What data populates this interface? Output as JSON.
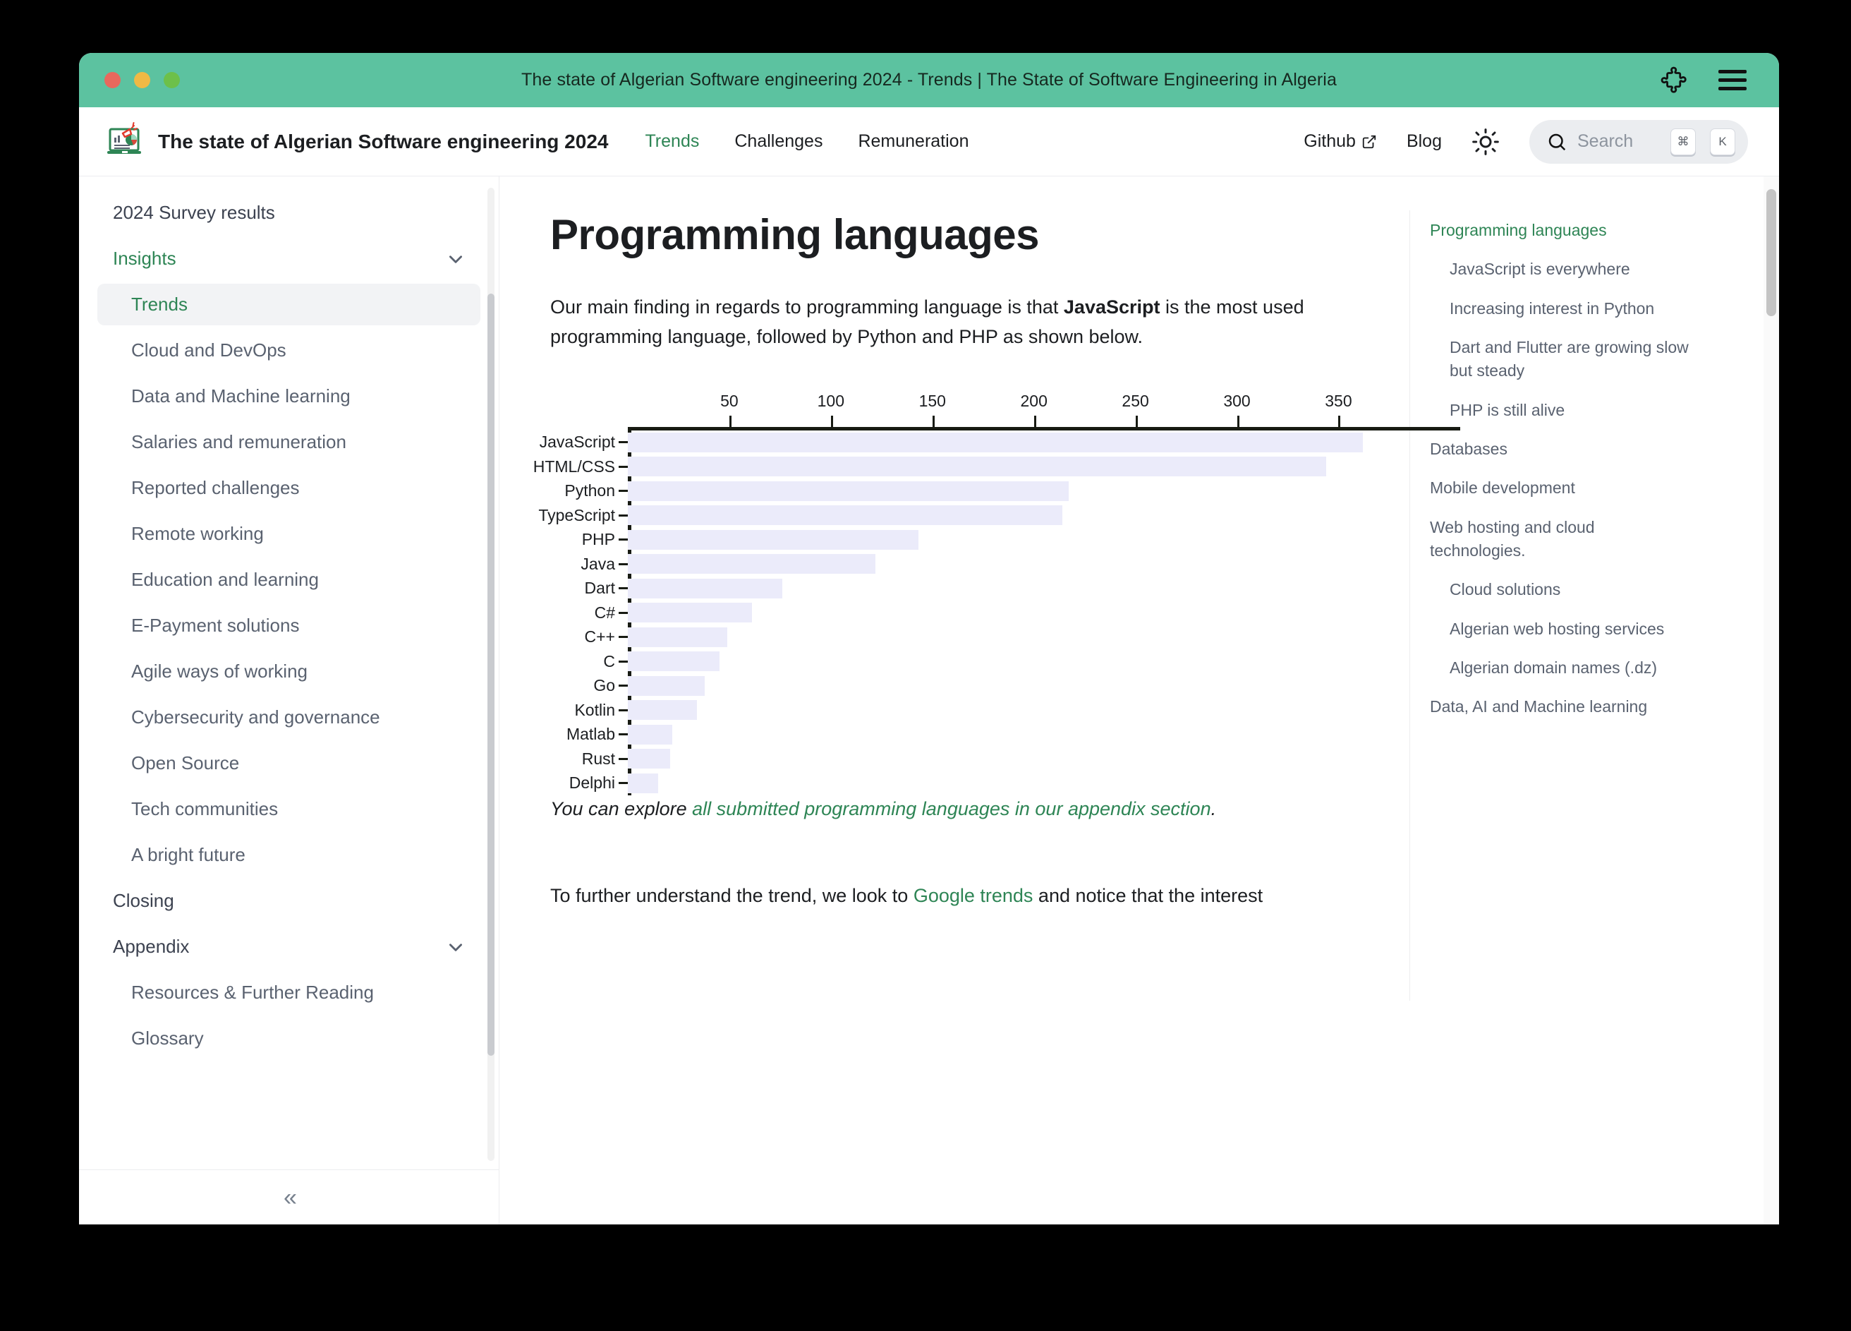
{
  "window": {
    "titlebar_title": "The state of Algerian Software engineering 2024 - Trends | The State of Software Engineering in Algeria",
    "puzzle_icon": "puzzle-extension-icon",
    "menu_icon": "hamburger-menu-icon"
  },
  "header": {
    "logo_icon": "laptop-chart-megaphone-logo",
    "brand_title": "The state of Algerian Software engineering 2024",
    "nav": [
      {
        "label": "Trends",
        "active": true
      },
      {
        "label": "Challenges",
        "active": false
      },
      {
        "label": "Remuneration",
        "active": false
      }
    ],
    "github_label": "Github",
    "external_link_icon": "external-link-icon",
    "blog_label": "Blog",
    "theme_icon": "sun-icon",
    "search": {
      "icon": "search-icon",
      "placeholder": "Search",
      "kbd_modifier": "⌘",
      "kbd_key": "K"
    }
  },
  "sidebar": {
    "items": [
      {
        "label": "2024 Survey results",
        "type": "category",
        "state": ""
      },
      {
        "label": "Insights",
        "type": "category",
        "state": "green",
        "chevron": true
      },
      {
        "label": "Trends",
        "type": "sub",
        "state": "active"
      },
      {
        "label": "Cloud and DevOps",
        "type": "sub",
        "state": ""
      },
      {
        "label": "Data and Machine learning",
        "type": "sub",
        "state": ""
      },
      {
        "label": "Salaries and remuneration",
        "type": "sub",
        "state": ""
      },
      {
        "label": "Reported challenges",
        "type": "sub",
        "state": ""
      },
      {
        "label": "Remote working",
        "type": "sub",
        "state": ""
      },
      {
        "label": "Education and learning",
        "type": "sub",
        "state": ""
      },
      {
        "label": "E-Payment solutions",
        "type": "sub",
        "state": ""
      },
      {
        "label": "Agile ways of working",
        "type": "sub",
        "state": ""
      },
      {
        "label": "Cybersecurity and governance",
        "type": "sub",
        "state": ""
      },
      {
        "label": "Open Source",
        "type": "sub",
        "state": ""
      },
      {
        "label": "Tech communities",
        "type": "sub",
        "state": ""
      },
      {
        "label": "A bright future",
        "type": "sub",
        "state": ""
      },
      {
        "label": "Closing",
        "type": "category",
        "state": ""
      },
      {
        "label": "Appendix",
        "type": "category",
        "state": "",
        "chevron": true
      },
      {
        "label": "Resources & Further Reading",
        "type": "sub",
        "state": ""
      },
      {
        "label": "Glossary",
        "type": "sub",
        "state": ""
      }
    ],
    "collapse_label": "«"
  },
  "main": {
    "page_title": "Programming languages",
    "paragraph_1a": "Our main finding in regards to programming language is that ",
    "paragraph_1b": "JavaScript",
    "paragraph_1c": " is the most used programming language, followed by Python and PHP as shown below.",
    "note_lead": "You can explore ",
    "note_link": "all submitted programming languages in our appendix section",
    "note_end": ".",
    "trailing_a": "To further understand the trend, we look to ",
    "trailing_link": "Google trends",
    "trailing_b": " and notice that the interest"
  },
  "toc": {
    "items": [
      {
        "label": "Programming languages",
        "level": 0,
        "active": true
      },
      {
        "label": "JavaScript is everywhere",
        "level": 1,
        "active": false
      },
      {
        "label": "Increasing interest in Python",
        "level": 1,
        "active": false
      },
      {
        "label": "Dart and Flutter are growing slow but steady",
        "level": 1,
        "active": false
      },
      {
        "label": "PHP is still alive",
        "level": 1,
        "active": false
      },
      {
        "label": "Databases",
        "level": 0,
        "active": false
      },
      {
        "label": "Mobile development",
        "level": 0,
        "active": false
      },
      {
        "label": "Web hosting and cloud technologies.",
        "level": 0,
        "active": false
      },
      {
        "label": "Cloud solutions",
        "level": 1,
        "active": false
      },
      {
        "label": "Algerian web hosting services",
        "level": 1,
        "active": false
      },
      {
        "label": "Algerian domain names (.dz)",
        "level": 1,
        "active": false
      },
      {
        "label": "Data, AI and Machine learning",
        "level": 0,
        "active": false
      }
    ]
  },
  "chart_data": {
    "type": "bar",
    "orientation": "horizontal",
    "title": "",
    "xlabel": "",
    "ylabel": "",
    "xlim": [
      0,
      370
    ],
    "xticks": [
      50,
      100,
      150,
      200,
      250,
      300,
      350
    ],
    "grid": false,
    "bar_color": "#ebebfa",
    "categories": [
      "JavaScript",
      "HTML/CSS",
      "Python",
      "TypeScript",
      "PHP",
      "Java",
      "Dart",
      "C#",
      "C++",
      "C",
      "Go",
      "Kotlin",
      "Matlab",
      "Rust",
      "Delphi"
    ],
    "values": [
      362,
      344,
      217,
      214,
      143,
      122,
      76,
      61,
      49,
      45,
      38,
      34,
      22,
      21,
      15
    ]
  },
  "colors": {
    "accent_green": "#2e8555",
    "titlebar": "#5cc2a0",
    "bar": "#ebebfa"
  }
}
